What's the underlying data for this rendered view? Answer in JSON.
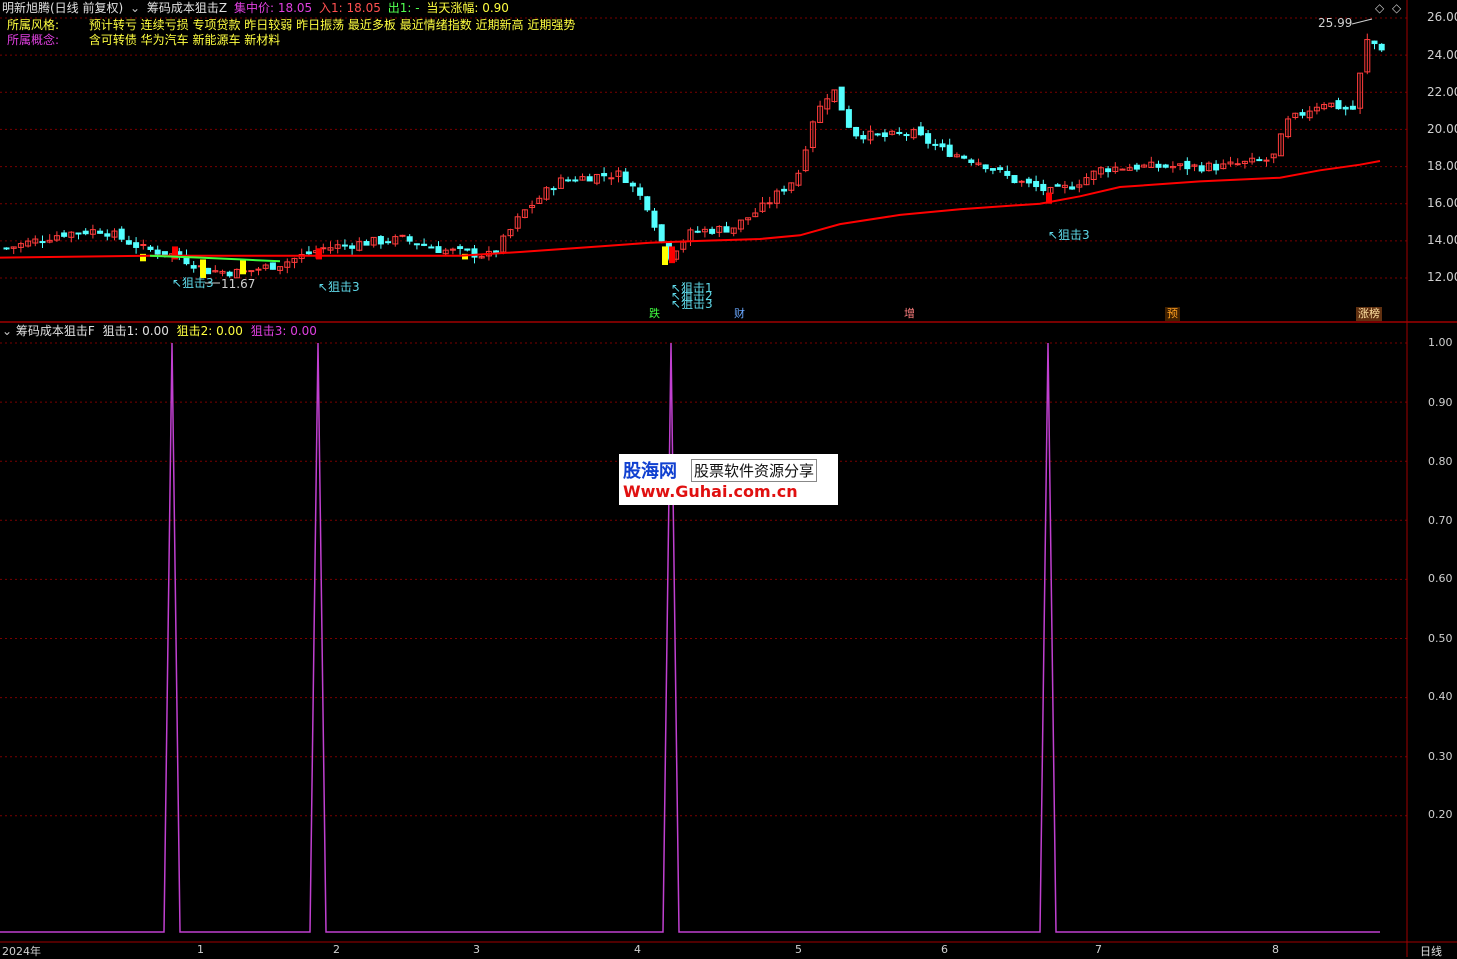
{
  "header": {
    "stock_name": "明新旭腾(日线 前复权)",
    "indicator_name": "筹码成本狙击Z",
    "concentration": "集中价: 18.05",
    "entry": "入1: 18.05",
    "exit": "出1: -",
    "daily_change": "当天涨幅: 0.90"
  },
  "tags": {
    "style_label": "所属风格:",
    "style_values": "预计转亏 连续亏损 专项贷款 昨日较弱 昨日振荡 最近多板 最近情绪指数 近期新高 近期强势",
    "concept_label": "所属概念:",
    "concept_values": "含可转债 华为汽车 新能源车 新材料"
  },
  "price_axis": [
    "26.00",
    "24.00",
    "22.00",
    "20.00",
    "18.00",
    "16.00",
    "14.00",
    "12.00"
  ],
  "annotations": {
    "high_price": "25.99",
    "low_price": "11.67",
    "snipe_a": "↖狙击3",
    "snipe_b": "↖狙击3",
    "snipe_c1": "↖狙击1",
    "snipe_c2": "↖狙击2",
    "snipe_c3": "↖狙击3",
    "snipe_d": "↖狙击3"
  },
  "events": [
    "跌",
    "财",
    "增",
    "预",
    "涨榜"
  ],
  "lower_panel": {
    "indicator_name": "筹码成本狙击F",
    "snipe1": "狙击1: 0.00",
    "snipe2": "狙击2: 0.00",
    "snipe3": "狙击3: 0.00",
    "axis": [
      "1.00",
      "0.90",
      "0.80",
      "0.70",
      "0.60",
      "0.50",
      "0.40",
      "0.30",
      "0.20"
    ]
  },
  "date_axis": [
    "2024年",
    "1",
    "2",
    "3",
    "4",
    "5",
    "6",
    "7",
    "8"
  ],
  "period_label": "日线",
  "watermark": {
    "brand": "股海网",
    "tagline": "股票软件资源分享",
    "url": "Www.Guhai.com.cn"
  },
  "colors": {
    "up": "#ff3c3c",
    "down": "#54ffff",
    "ma_line": "#ff0000",
    "indicator_line": "#c040d0",
    "grid": "#7a0000"
  },
  "signal_spike_values": [
    1.0,
    1.0,
    1.0,
    1.0
  ]
}
